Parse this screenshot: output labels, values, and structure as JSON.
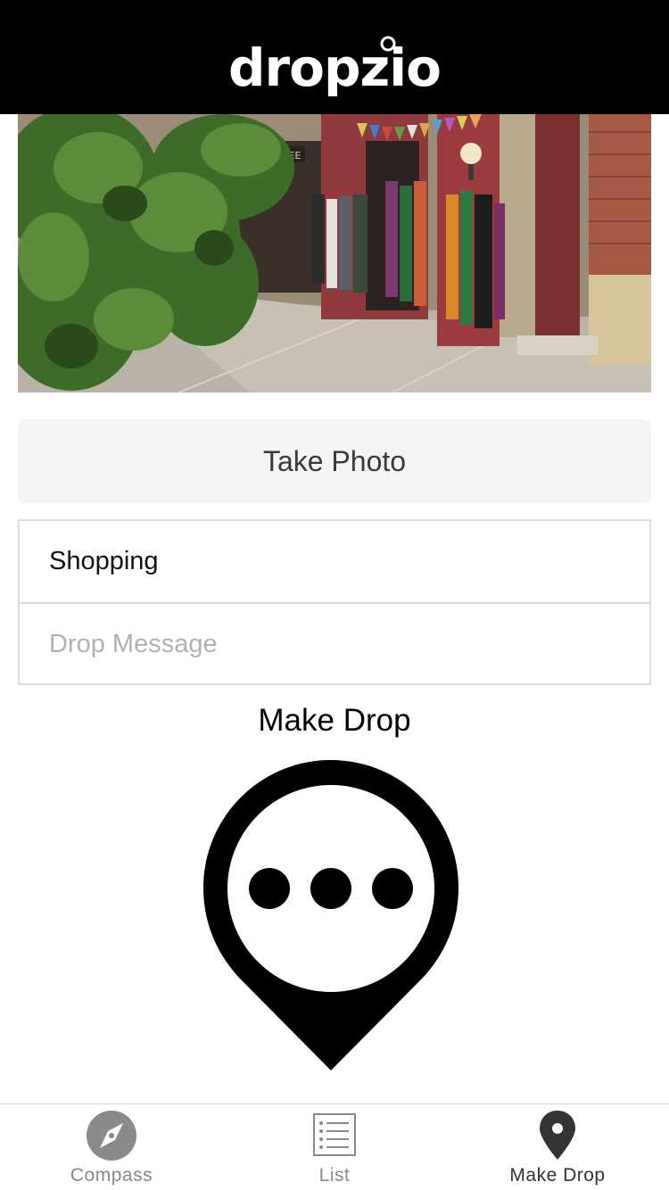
{
  "header": {
    "logo_text": "dropzio",
    "logo_icon": "location-pin-icon",
    "background": "#000000"
  },
  "photo": {
    "description_icon": "storefront-photo",
    "sign_text": "COFFEE"
  },
  "take_photo_button": {
    "label": "Take Photo"
  },
  "form": {
    "category_value": "Shopping",
    "message_placeholder": "Drop Message",
    "message_value": ""
  },
  "make_drop": {
    "label": "Make Drop",
    "icon": "map-pin-chat-icon"
  },
  "tabbar": {
    "tabs": [
      {
        "label": "Compass",
        "icon": "compass-icon",
        "active": false
      },
      {
        "label": "List",
        "icon": "list-icon",
        "active": false
      },
      {
        "label": "Make Drop",
        "icon": "map-pin-icon",
        "active": true
      }
    ]
  },
  "colors": {
    "accent": "#000000",
    "button_bg": "#f4f4f4",
    "border": "#dcdcdc",
    "placeholder": "#b2b2b2",
    "inactive_tab": "#8a8a8a"
  }
}
